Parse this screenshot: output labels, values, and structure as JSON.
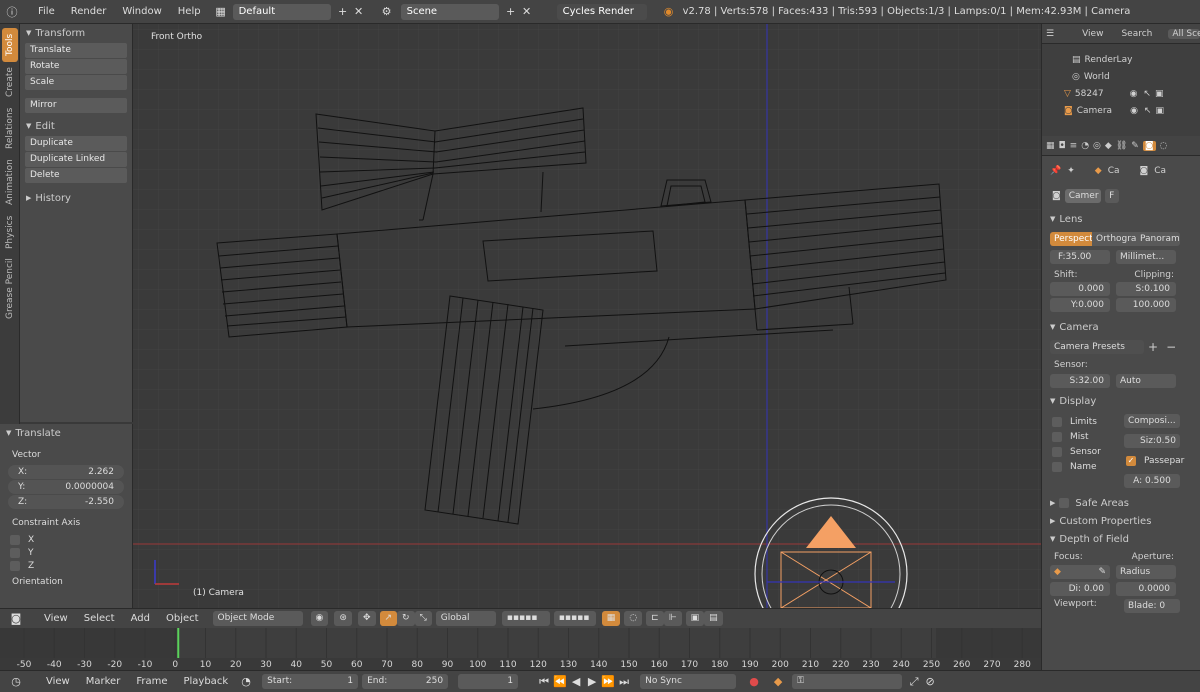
{
  "topbar": {
    "menus": [
      "File",
      "Render",
      "Window",
      "Help"
    ],
    "screen_layout": "Default",
    "scene": "Scene",
    "render_engine": "Cycles Render",
    "stats": "v2.78 | Verts:578 | Faces:433 | Tris:593 | Objects:1/3 | Lamps:0/1 | Mem:42.93M | Camera"
  },
  "left_tabs": [
    "Tools",
    "Create",
    "Relations",
    "Animation",
    "Physics",
    "Grease Pencil"
  ],
  "toolshelf": {
    "transform_header": "Transform",
    "transform_buttons": [
      "Translate",
      "Rotate",
      "Scale",
      "Mirror"
    ],
    "edit_header": "Edit",
    "edit_buttons": [
      "Duplicate",
      "Duplicate Linked",
      "Delete"
    ],
    "history_header": "History"
  },
  "redo_panel": {
    "header": "Translate",
    "vector_label": "Vector",
    "x": {
      "label": "X:",
      "value": "2.262"
    },
    "y": {
      "label": "Y:",
      "value": "0.0000004"
    },
    "z": {
      "label": "Z:",
      "value": "-2.550"
    },
    "constraint_label": "Constraint Axis",
    "axes": [
      "X",
      "Y",
      "Z"
    ],
    "orientation_label": "Orientation"
  },
  "viewport": {
    "view_name": "Front Ortho",
    "object_label": "(1) Camera"
  },
  "outliner": {
    "tabs": [
      "View",
      "Search",
      "All Sce"
    ],
    "items": [
      "RenderLay",
      "World",
      "58247",
      "Camera"
    ]
  },
  "properties": {
    "context_items": [
      "Ca",
      "Ca"
    ],
    "data_name": "Camer",
    "data_f": "F",
    "lens_header": "Lens",
    "lens_types": [
      "Perspecti",
      "Orthograp",
      "Panorami"
    ],
    "focal": "F:35.00",
    "lens_unit": "Millimet...",
    "shift_label": "Shift:",
    "clipping_label": "Clipping:",
    "shift_x": "0.000",
    "shift_y": "Y:0.000",
    "clip_start": "S:0.100",
    "clip_end": "100.000",
    "camera_header": "Camera",
    "camera_presets": "Camera Presets",
    "sensor_label": "Sensor:",
    "sensor_size": "S:32.00",
    "sensor_fit": "Auto",
    "display_header": "Display",
    "display_limits": "Limits",
    "display_mist": "Mist",
    "display_sensor": "Sensor",
    "display_name": "Name",
    "composition": "Composi...",
    "size": "Siz:0.50",
    "passepartout": "Passepar",
    "alpha": "A: 0.500",
    "safe_areas": "Safe Areas",
    "custom_props": "Custom Properties",
    "dof_header": "Depth of Field",
    "focus_label": "Focus:",
    "aperture_label": "Aperture:",
    "aperture_type": "Radius",
    "distance": "Di: 0.00",
    "aperture_value": "0.0000",
    "viewport_label": "Viewport:",
    "blades": "Blade: 0"
  },
  "view_header": {
    "menus": [
      "View",
      "Select",
      "Add",
      "Object"
    ],
    "mode": "Object Mode",
    "orientation": "Global"
  },
  "timeline": {
    "ticks": [
      "-50",
      "-40",
      "-30",
      "-20",
      "-10",
      "0",
      "10",
      "20",
      "30",
      "40",
      "50",
      "60",
      "70",
      "80",
      "90",
      "100",
      "110",
      "120",
      "130",
      "140",
      "150",
      "160",
      "170",
      "180",
      "190",
      "200",
      "210",
      "220",
      "230",
      "240",
      "250",
      "260",
      "270",
      "280"
    ],
    "current_frame_value": 1
  },
  "timeline_header": {
    "menus": [
      "View",
      "Marker",
      "Frame",
      "Playback"
    ],
    "start": "Start:",
    "start_value": "1",
    "end": "End:",
    "end_value": "250",
    "current": "1",
    "sync": "No Sync"
  },
  "colors": {
    "accent": "#d28a3c",
    "wire": "#111111",
    "x_axis": "#b03a3a",
    "z_axis": "#3b3bd0",
    "camera_orange": "#f4a064"
  }
}
